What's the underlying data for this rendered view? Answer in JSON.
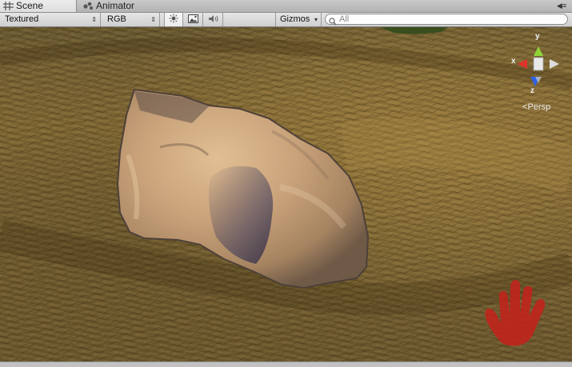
{
  "tabs": [
    {
      "label": "Scene",
      "icon": "grid-icon",
      "active": true
    },
    {
      "label": "Animator",
      "icon": "animator-icon",
      "active": false
    }
  ],
  "toolbar": {
    "render_mode": "Textured",
    "channel_mode": "RGB",
    "gizmos_label": "Gizmos",
    "search_placeholder": "All"
  },
  "gizmo": {
    "axis_y": "y",
    "axis_x": "x",
    "axis_z": "z",
    "projection": "Persp",
    "colors": {
      "y": "#8ed43a",
      "x": "#e0322a",
      "z": "#2f62e0"
    }
  },
  "colors": {
    "ground": "#7a6430",
    "rock": "#c9a27a",
    "hand_logo": "#c0241c"
  }
}
